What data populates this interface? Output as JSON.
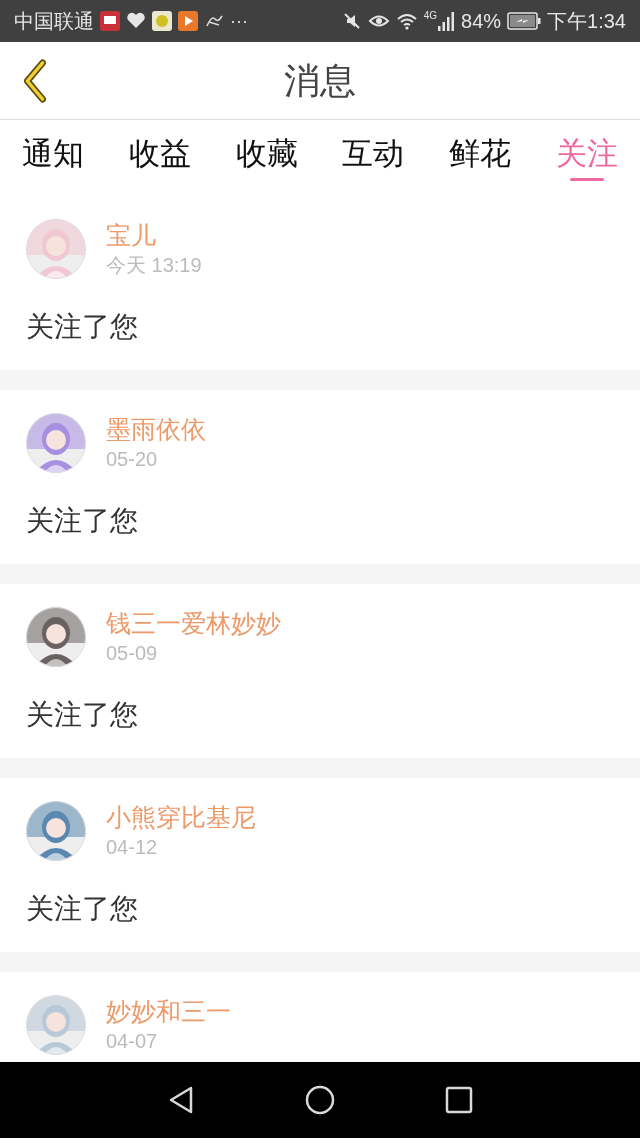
{
  "status_bar": {
    "carrier": "中国联通",
    "more": "···",
    "network": "4G",
    "battery": "84%",
    "time": "下午1:34"
  },
  "header": {
    "title": "消息"
  },
  "tabs": [
    {
      "label": "通知",
      "selected": false
    },
    {
      "label": "收益",
      "selected": false
    },
    {
      "label": "收藏",
      "selected": false
    },
    {
      "label": "互动",
      "selected": false
    },
    {
      "label": "鲜花",
      "selected": false
    },
    {
      "label": "关注",
      "selected": true
    }
  ],
  "messages": [
    {
      "name": "宝儿",
      "time": "今天 13:19",
      "text": "关注了您"
    },
    {
      "name": "墨雨依依",
      "time": "05-20",
      "text": "关注了您"
    },
    {
      "name": "钱三一爱林妙妙",
      "time": "05-09",
      "text": "关注了您"
    },
    {
      "name": "小熊穿比基尼",
      "time": "04-12",
      "text": "关注了您"
    },
    {
      "name": "妙妙和三一",
      "time": "04-07"
    }
  ]
}
